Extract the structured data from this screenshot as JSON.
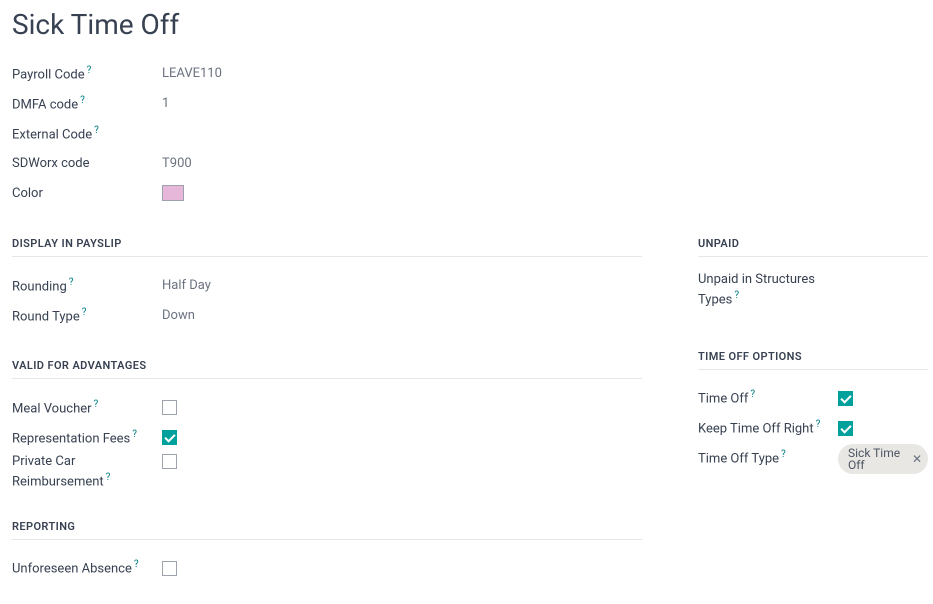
{
  "title": "Sick Time Off",
  "top_fields": {
    "payroll_code": {
      "label": "Payroll Code",
      "value": "LEAVE110",
      "help": true
    },
    "dmfa_code": {
      "label": "DMFA code",
      "value": "1",
      "help": true
    },
    "external_code": {
      "label": "External Code",
      "value": "",
      "help": true
    },
    "sdworx_code": {
      "label": "SDWorx code",
      "value": "T900",
      "help": false
    },
    "color": {
      "label": "Color",
      "swatch": "#e6b7d9",
      "help": false
    }
  },
  "sections": {
    "display_in_payslip": {
      "title": "DISPLAY IN PAYSLIP",
      "rounding": {
        "label": "Rounding",
        "value": "Half Day",
        "help": true
      },
      "round_type": {
        "label": "Round Type",
        "value": "Down",
        "help": true
      }
    },
    "valid_for_advantages": {
      "title": "VALID FOR ADVANTAGES",
      "meal_voucher": {
        "label": "Meal Voucher",
        "checked": false,
        "help": true
      },
      "representation_fees": {
        "label": "Representation Fees",
        "checked": true,
        "help": true
      },
      "private_car": {
        "label": "Private Car Reimbursement",
        "checked": false,
        "help": true
      }
    },
    "reporting": {
      "title": "REPORTING",
      "unforeseen_absence": {
        "label": "Unforeseen Absence",
        "checked": false,
        "help": true
      }
    },
    "unpaid": {
      "title": "UNPAID",
      "unpaid_structures": {
        "label": "Unpaid in Structures Types",
        "value": "",
        "help": true
      }
    },
    "time_off_options": {
      "title": "TIME OFF OPTIONS",
      "time_off": {
        "label": "Time Off",
        "checked": true,
        "help": true
      },
      "keep_right": {
        "label": "Keep Time Off Right",
        "checked": true,
        "help": true
      },
      "time_off_type": {
        "label": "Time Off Type",
        "tag": "Sick Time Off",
        "help": true
      }
    }
  }
}
